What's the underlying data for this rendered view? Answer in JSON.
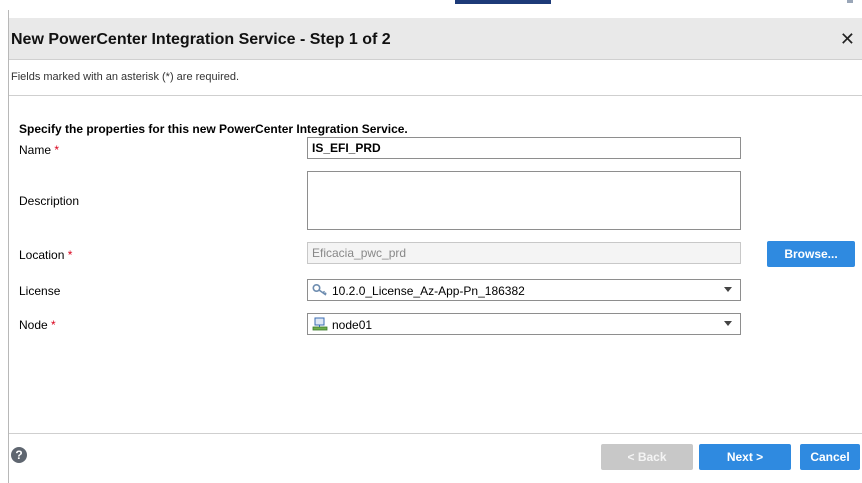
{
  "dialog": {
    "title": "New PowerCenter Integration Service - Step 1 of 2",
    "close_icon": "close-icon"
  },
  "required_note": "Fields marked with an asterisk (*) are required.",
  "section_heading": "Specify the properties for this new PowerCenter Integration Service.",
  "fields": {
    "name": {
      "label": "Name",
      "required": "*",
      "value": "IS_EFI_PRD"
    },
    "description": {
      "label": "Description",
      "value": ""
    },
    "location": {
      "label": "Location",
      "required": "*",
      "value": "Eficacia_pwc_prd"
    },
    "license": {
      "label": "License",
      "value": "10.2.0_License_Az-App-Pn_186382",
      "icon": "license-key-icon"
    },
    "node": {
      "label": "Node",
      "required": "*",
      "value": "node01",
      "icon": "node-computer-icon"
    }
  },
  "buttons": {
    "browse": "Browse...",
    "back": "< Back",
    "next": "Next >",
    "cancel": "Cancel"
  },
  "help_icon": "help-icon",
  "colors": {
    "accent": "#2f8ae0",
    "required": "#d9001b",
    "titlebar": "#e9e9e9"
  }
}
